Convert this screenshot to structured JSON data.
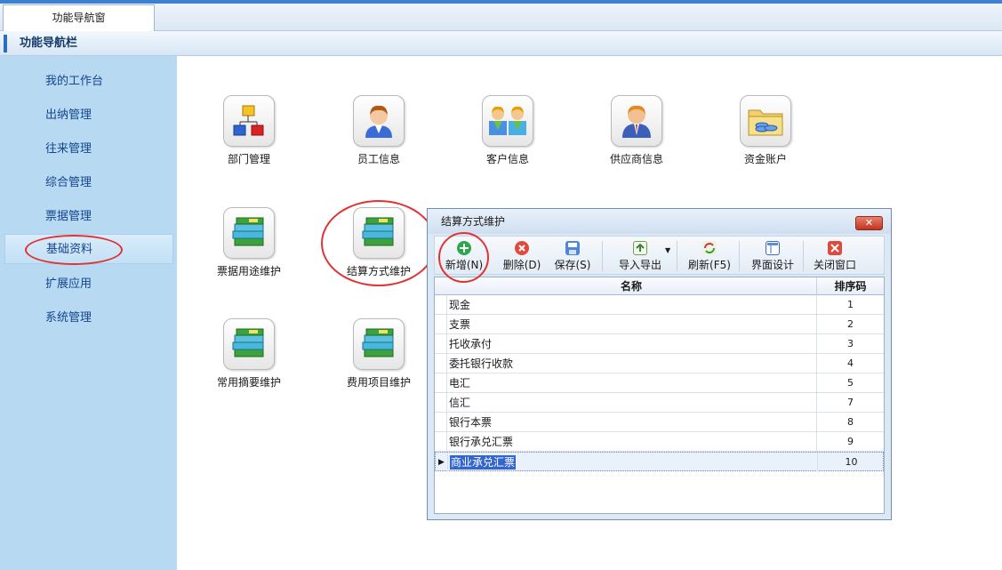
{
  "tabs": [
    {
      "label": "功能导航窗"
    }
  ],
  "nav": {
    "title": "功能导航栏"
  },
  "sidebar": {
    "items": [
      {
        "label": "我的工作台"
      },
      {
        "label": "出纳管理"
      },
      {
        "label": "往来管理"
      },
      {
        "label": "综合管理"
      },
      {
        "label": "票据管理"
      },
      {
        "label": "基础资料"
      },
      {
        "label": "扩展应用"
      },
      {
        "label": "系统管理"
      }
    ],
    "active_index": 5
  },
  "main": {
    "tiles": [
      {
        "label": "部门管理",
        "icon": "org-chart-icon"
      },
      {
        "label": "员工信息",
        "icon": "employee-icon"
      },
      {
        "label": "客户信息",
        "icon": "customers-icon"
      },
      {
        "label": "供应商信息",
        "icon": "supplier-icon"
      },
      {
        "label": "资金账户",
        "icon": "fund-account-icon"
      },
      {
        "label": "票据用途维护",
        "icon": "books-icon"
      },
      {
        "label": "结算方式维护",
        "icon": "books-icon"
      },
      {
        "label": "常用摘要维护",
        "icon": "books-icon"
      },
      {
        "label": "费用项目维护",
        "icon": "books-icon"
      }
    ]
  },
  "dialog": {
    "title": "结算方式维护",
    "close_label": "✕",
    "toolbar": [
      {
        "label": "新增(N)",
        "icon": "add-icon"
      },
      {
        "label": "删除(D)",
        "icon": "delete-icon"
      },
      {
        "label": "保存(S)",
        "icon": "save-icon"
      },
      {
        "label": "导入导出",
        "icon": "import-export-icon"
      },
      {
        "label": "刷新(F5)",
        "icon": "refresh-icon"
      },
      {
        "label": "界面设计",
        "icon": "layout-design-icon"
      },
      {
        "label": "关闭窗口",
        "icon": "close-window-icon"
      }
    ],
    "columns": [
      "名称",
      "排序码"
    ],
    "rows": [
      {
        "name": "现金",
        "code": "1"
      },
      {
        "name": "支票",
        "code": "2"
      },
      {
        "name": "托收承付",
        "code": "3"
      },
      {
        "name": "委托银行收款",
        "code": "4"
      },
      {
        "name": "电汇",
        "code": "5"
      },
      {
        "name": "信汇",
        "code": "7"
      },
      {
        "name": "银行本票",
        "code": "8"
      },
      {
        "name": "银行承兑汇票",
        "code": "9"
      },
      {
        "name": "商业承兑汇票",
        "code": "10"
      }
    ],
    "selected_row": 8
  },
  "colors": {
    "accent": "#3f7fcf",
    "sidebar_bg": "#b7d9f1",
    "highlight": "#e03434",
    "nav_text": "#14468d"
  }
}
